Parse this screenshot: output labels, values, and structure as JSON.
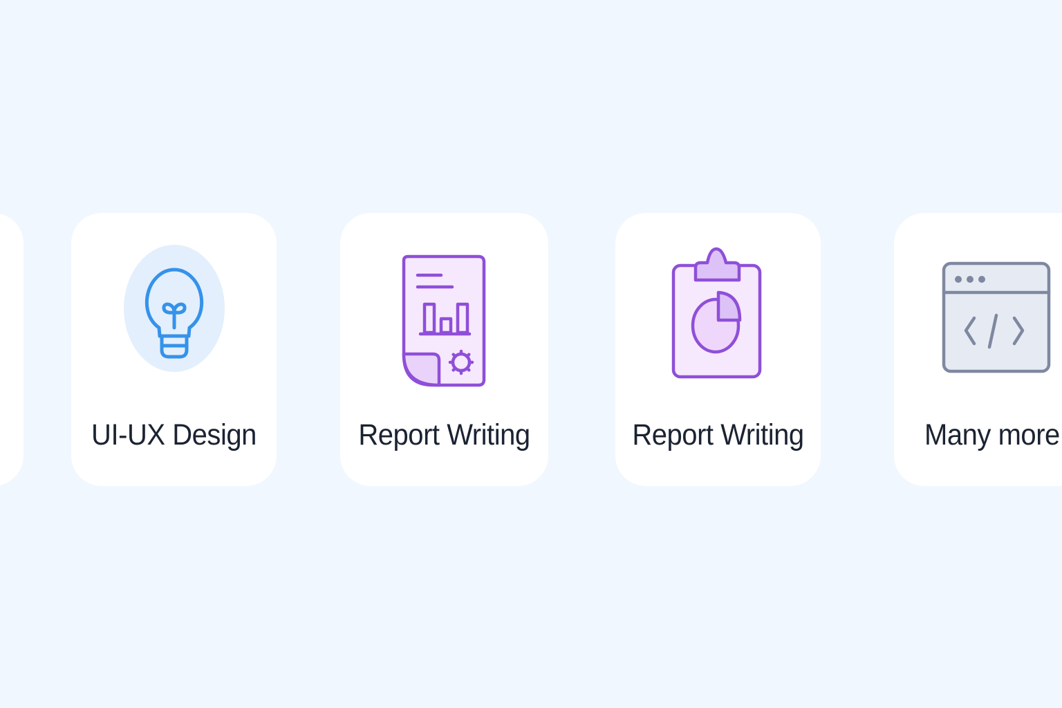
{
  "services": [
    {
      "label": "",
      "icon": "card-partial"
    },
    {
      "label": "UI-UX Design",
      "icon": "lightbulb-icon",
      "color": "#3592ea",
      "bg": "#e3effc"
    },
    {
      "label": "Report Writing",
      "icon": "report-document-icon",
      "color": "#8f4fd8",
      "bg": "#f7e9fd"
    },
    {
      "label": "Report Writing",
      "icon": "clipboard-chart-icon",
      "color": "#8f4fd8",
      "bg": "#f7e9fd"
    },
    {
      "label": "Many more",
      "icon": "code-window-icon",
      "color": "#7f88a0",
      "bg": "#e6ebf3"
    }
  ],
  "colors": {
    "page_background": "#f1f7fe",
    "card_background": "#ffffff",
    "label_text": "#1b2332"
  }
}
